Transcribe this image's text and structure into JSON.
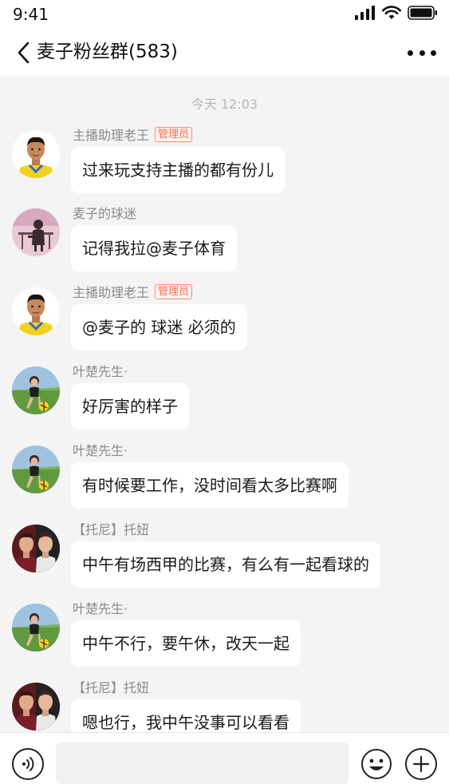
{
  "status_bar": {
    "time": "9:41"
  },
  "nav": {
    "title": "麦子粉丝群(583)"
  },
  "timestamp": "今天 12:03",
  "messages": [
    {
      "sender": "主播助理老王",
      "badge": "管理员",
      "text": "过来玩支持主播的都有份儿",
      "avatar": "player-yellow-jersey-avatar"
    },
    {
      "sender": "麦子的球迷",
      "badge": "",
      "text": "记得我拉@麦子体育",
      "avatar": "silhouette-room-avatar"
    },
    {
      "sender": "主播助理老王",
      "badge": "管理员",
      "text": "@麦子的 球迷 必须的",
      "avatar": "player-yellow-jersey-avatar"
    },
    {
      "sender": "叶楚先生·",
      "badge": "",
      "text": "好厉害的样子",
      "avatar": "woman-football-field-avatar"
    },
    {
      "sender": "叶楚先生·",
      "badge": "",
      "text": "有时候要工作，没时间看太多比赛啊",
      "avatar": "woman-football-field-avatar"
    },
    {
      "sender": "【托尼】托妞",
      "badge": "",
      "text": "中午有场西甲的比赛，有么有一起看球的",
      "avatar": "two-players-avatar"
    },
    {
      "sender": "叶楚先生·",
      "badge": "",
      "text": "中午不行，要午休，改天一起",
      "avatar": "woman-football-field-avatar"
    },
    {
      "sender": "【托尼】托妞",
      "badge": "",
      "text": "嗯也行，我中午没事可以看看",
      "avatar": "two-players-avatar"
    }
  ],
  "input": {
    "placeholder": ""
  },
  "colors": {
    "badge": "#ff6a4a",
    "chat_bg": "#f4f4f4",
    "bubble": "#ffffff"
  }
}
